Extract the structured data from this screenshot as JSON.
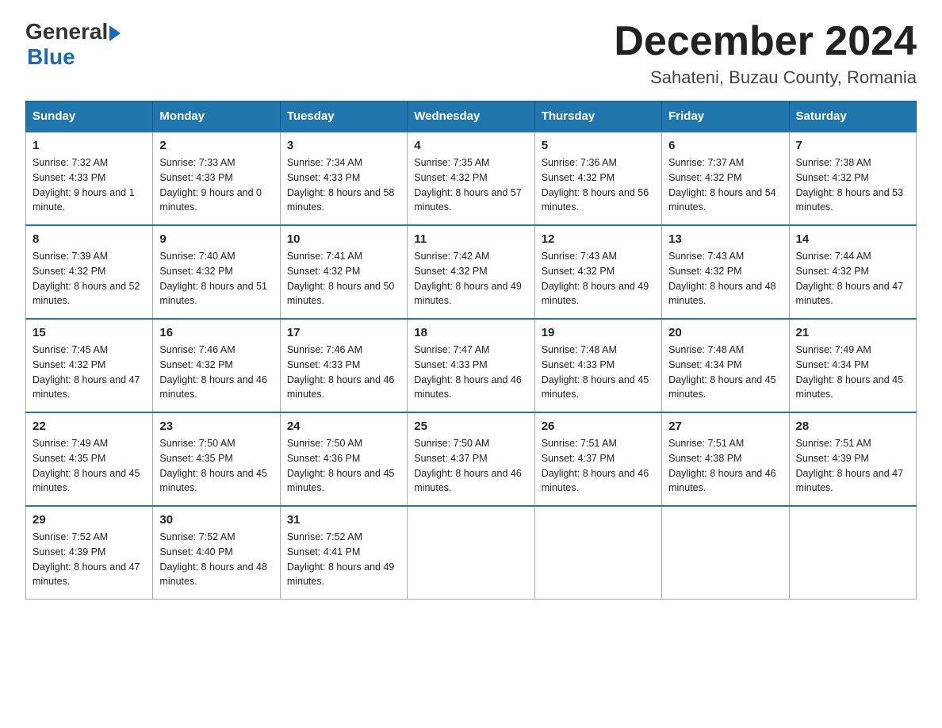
{
  "header": {
    "logo_general": "General",
    "logo_blue": "Blue",
    "title": "December 2024",
    "subtitle": "Sahateni, Buzau County, Romania"
  },
  "days_of_week": [
    "Sunday",
    "Monday",
    "Tuesday",
    "Wednesday",
    "Thursday",
    "Friday",
    "Saturday"
  ],
  "weeks": [
    [
      {
        "day": "1",
        "sunrise": "7:32 AM",
        "sunset": "4:33 PM",
        "daylight": "9 hours and 1 minute."
      },
      {
        "day": "2",
        "sunrise": "7:33 AM",
        "sunset": "4:33 PM",
        "daylight": "9 hours and 0 minutes."
      },
      {
        "day": "3",
        "sunrise": "7:34 AM",
        "sunset": "4:33 PM",
        "daylight": "8 hours and 58 minutes."
      },
      {
        "day": "4",
        "sunrise": "7:35 AM",
        "sunset": "4:32 PM",
        "daylight": "8 hours and 57 minutes."
      },
      {
        "day": "5",
        "sunrise": "7:36 AM",
        "sunset": "4:32 PM",
        "daylight": "8 hours and 56 minutes."
      },
      {
        "day": "6",
        "sunrise": "7:37 AM",
        "sunset": "4:32 PM",
        "daylight": "8 hours and 54 minutes."
      },
      {
        "day": "7",
        "sunrise": "7:38 AM",
        "sunset": "4:32 PM",
        "daylight": "8 hours and 53 minutes."
      }
    ],
    [
      {
        "day": "8",
        "sunrise": "7:39 AM",
        "sunset": "4:32 PM",
        "daylight": "8 hours and 52 minutes."
      },
      {
        "day": "9",
        "sunrise": "7:40 AM",
        "sunset": "4:32 PM",
        "daylight": "8 hours and 51 minutes."
      },
      {
        "day": "10",
        "sunrise": "7:41 AM",
        "sunset": "4:32 PM",
        "daylight": "8 hours and 50 minutes."
      },
      {
        "day": "11",
        "sunrise": "7:42 AM",
        "sunset": "4:32 PM",
        "daylight": "8 hours and 49 minutes."
      },
      {
        "day": "12",
        "sunrise": "7:43 AM",
        "sunset": "4:32 PM",
        "daylight": "8 hours and 49 minutes."
      },
      {
        "day": "13",
        "sunrise": "7:43 AM",
        "sunset": "4:32 PM",
        "daylight": "8 hours and 48 minutes."
      },
      {
        "day": "14",
        "sunrise": "7:44 AM",
        "sunset": "4:32 PM",
        "daylight": "8 hours and 47 minutes."
      }
    ],
    [
      {
        "day": "15",
        "sunrise": "7:45 AM",
        "sunset": "4:32 PM",
        "daylight": "8 hours and 47 minutes."
      },
      {
        "day": "16",
        "sunrise": "7:46 AM",
        "sunset": "4:32 PM",
        "daylight": "8 hours and 46 minutes."
      },
      {
        "day": "17",
        "sunrise": "7:46 AM",
        "sunset": "4:33 PM",
        "daylight": "8 hours and 46 minutes."
      },
      {
        "day": "18",
        "sunrise": "7:47 AM",
        "sunset": "4:33 PM",
        "daylight": "8 hours and 46 minutes."
      },
      {
        "day": "19",
        "sunrise": "7:48 AM",
        "sunset": "4:33 PM",
        "daylight": "8 hours and 45 minutes."
      },
      {
        "day": "20",
        "sunrise": "7:48 AM",
        "sunset": "4:34 PM",
        "daylight": "8 hours and 45 minutes."
      },
      {
        "day": "21",
        "sunrise": "7:49 AM",
        "sunset": "4:34 PM",
        "daylight": "8 hours and 45 minutes."
      }
    ],
    [
      {
        "day": "22",
        "sunrise": "7:49 AM",
        "sunset": "4:35 PM",
        "daylight": "8 hours and 45 minutes."
      },
      {
        "day": "23",
        "sunrise": "7:50 AM",
        "sunset": "4:35 PM",
        "daylight": "8 hours and 45 minutes."
      },
      {
        "day": "24",
        "sunrise": "7:50 AM",
        "sunset": "4:36 PM",
        "daylight": "8 hours and 45 minutes."
      },
      {
        "day": "25",
        "sunrise": "7:50 AM",
        "sunset": "4:37 PM",
        "daylight": "8 hours and 46 minutes."
      },
      {
        "day": "26",
        "sunrise": "7:51 AM",
        "sunset": "4:37 PM",
        "daylight": "8 hours and 46 minutes."
      },
      {
        "day": "27",
        "sunrise": "7:51 AM",
        "sunset": "4:38 PM",
        "daylight": "8 hours and 46 minutes."
      },
      {
        "day": "28",
        "sunrise": "7:51 AM",
        "sunset": "4:39 PM",
        "daylight": "8 hours and 47 minutes."
      }
    ],
    [
      {
        "day": "29",
        "sunrise": "7:52 AM",
        "sunset": "4:39 PM",
        "daylight": "8 hours and 47 minutes."
      },
      {
        "day": "30",
        "sunrise": "7:52 AM",
        "sunset": "4:40 PM",
        "daylight": "8 hours and 48 minutes."
      },
      {
        "day": "31",
        "sunrise": "7:52 AM",
        "sunset": "4:41 PM",
        "daylight": "8 hours and 49 minutes."
      },
      null,
      null,
      null,
      null
    ]
  ],
  "labels": {
    "sunrise": "Sunrise:",
    "sunset": "Sunset:",
    "daylight": "Daylight:"
  }
}
